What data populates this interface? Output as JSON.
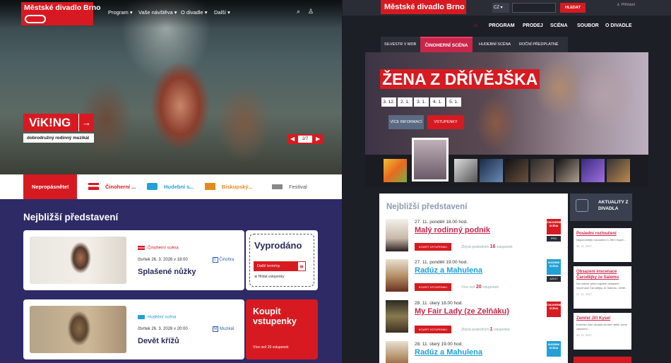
{
  "left": {
    "logo": "Městské divadlo Brno",
    "nav": [
      "Program",
      "Vaše návštěva",
      "O divadle",
      "Další"
    ],
    "hero": {
      "title": "ViK!NG",
      "subtitle": "dobrodružný rodinný muzikál",
      "pager": "2/7"
    },
    "tabs": [
      "Nepropásněte!",
      "Činoherní ...",
      "Hudební s...",
      "Biskupský...",
      "Festival"
    ],
    "section_title": "Nejbližší představení",
    "cards": [
      {
        "category": "Činoherní scéna",
        "date": "čtvrtek 26. 3. 2026 v 18:00",
        "tag": "Činohra",
        "title": "Splašené nůžky"
      },
      {
        "category": "Hudební scéna",
        "date": "čtvrtek 26. 3. 2026 v 20:00",
        "tag": "Muzikál",
        "title": "Devět křížů"
      }
    ],
    "side1": {
      "title": "Vyprodáno",
      "btn": "Další termíny",
      "watch": "Hlídat vstupenky"
    },
    "side2": {
      "title": "Koupit vstupenky",
      "note": "Více než 20 vstupenek"
    }
  },
  "right": {
    "logo": "Městské divadlo Brno",
    "lang": "CZ",
    "search_btn": "HLEDAT",
    "login": "Přihlásit",
    "nav": [
      "PROGRAM",
      "PRODEJ",
      "SCÉNA",
      "SOUBOR",
      "O DIVADLE"
    ],
    "subtabs": [
      "SILVESTR V MDB",
      "ČINOHERNÍ SCÉNA",
      "HUDEBNÍ SCÉNA",
      "ROČNÍ PŘEDPLATNÉ 2018"
    ],
    "hero": {
      "title": "ŽENA Z DŘÍVĚJŠKA",
      "dates": [
        "3. 12.",
        "2. 1.",
        "3. 1.",
        "4. 1.",
        "5. 1."
      ],
      "more": "VÍCE INFORMACÍ",
      "tickets": "VSTUPENKY"
    },
    "list_title": "Nejbližší představení",
    "rows": [
      {
        "date": "27. 11. pondělí 18.00 hod.",
        "title": "Malý rodinný podnik",
        "buy": "KOUPIT VSTUPENKU",
        "free_pre": "Zbývá posledních",
        "free": "16",
        "free_post": "vstupenek",
        "stage": "ČINOHERNÍ SCÉNA",
        "code": "PPD",
        "blue": false
      },
      {
        "date": "27. 11. pondělí 19.00 hod.",
        "title": "Radúz a Mahulena",
        "buy": "KOUPIT VSTUPENKU",
        "free_pre": "Více než",
        "free": "20",
        "free_post": "vstupenek",
        "stage": "HUDEBNÍ SCÉNA",
        "code": "A2017",
        "blue": true
      },
      {
        "date": "28. 11. úterý 18.00 hod.",
        "title": "My Fair Lady (ze Zelňáku)",
        "buy": "KOUPIT VSTUPENKU",
        "free_pre": "Zbývá posledních",
        "free": "1",
        "free_post": "vstupenka",
        "stage": "ČINOHERNÍ SCÉNA",
        "code": "",
        "blue": false
      },
      {
        "date": "28. 11. úterý 19.00 hod.",
        "title": "Radúz a Mahulena",
        "buy": "",
        "free_pre": "",
        "free": "",
        "free_post": "",
        "stage": "HUDEBNÍ SCÉNA",
        "code": "",
        "blue": true
      }
    ],
    "news_header": "AKTUALITY Z DIVADLA",
    "news": [
      {
        "title": "Poslední rozloučení",
        "text": "Nejsmutnější rozloučení s Jiřím Kysel...",
        "date": "30. 11. 2017"
      },
      {
        "title": "Obsazení inscenace Čarodějky ze Salemu",
        "text": "Na našem webu najdete obsazení inscenace Čarodějky ze Salemu. Ještě...",
        "date": "27. 11. 2017"
      },
      {
        "title": "Zemřel Jiří Kysel",
        "text": "Emeritní člen divadla zemřel náhle, jsme zasaženi...",
        "date": "20. 11. 2017"
      }
    ]
  },
  "colors": {
    "red": "#d71a21",
    "navy": "#2e2a66",
    "blue": "#23a0d6"
  }
}
